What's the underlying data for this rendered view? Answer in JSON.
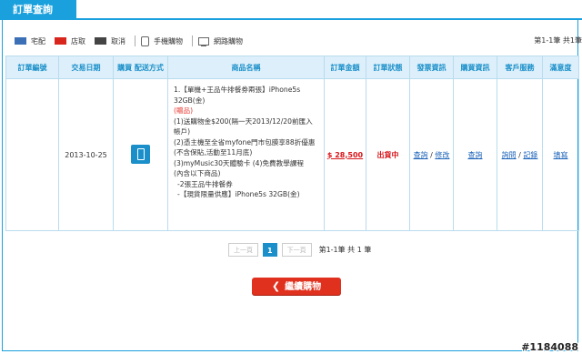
{
  "tab": {
    "title": "訂單查詢"
  },
  "legend": [
    {
      "label": "宅配",
      "color": "#3b6fb6",
      "icon": "swatch"
    },
    {
      "label": "店取",
      "color": "#d8261d",
      "icon": "swatch"
    },
    {
      "label": "取消",
      "color": "#444444",
      "icon": "swatch"
    },
    {
      "label": "手機購物",
      "icon": "mobile-icon"
    },
    {
      "label": "網路購物",
      "icon": "monitor-icon"
    }
  ],
  "count_text": "第1-1筆 共1筆",
  "columns": [
    "訂單編號",
    "交易日期",
    "購買 配送方式",
    "商品名稱",
    "訂單金額",
    "訂單狀態",
    "發票資訊",
    "購買資訊",
    "客戶服務",
    "滿意度"
  ],
  "order": {
    "order_no": "",
    "date": "2013-10-25",
    "product_lines": [
      "1.【單機+王品牛排餐券兩張】iPhone5s 32GB(金)",
      "(贈品)",
      "(1)送購物金$200(隔一天2013/12/20前匯入帳戶)",
      "(2)憑主機至全省myfone門市包膜享88折優惠(不含保貼,活動至11月底)",
      "(3)myMusic30天體驗卡 (4)免費教學課程",
      "(內含以下商品)",
      "-2張王品牛排餐券",
      "-【現貨限量供應】iPhone5s 32GB(金)"
    ],
    "amount": "$ 28,500",
    "status": "出貨中",
    "invoice_links": [
      "查詢",
      "修改"
    ],
    "purchase_link": "查詢",
    "service_links": [
      "詢問",
      "記錄"
    ],
    "satisfaction_link": "填寫"
  },
  "pager": {
    "prev": "上一頁",
    "current": "1",
    "next": "下一頁",
    "info": "第1-1筆 共 1 筆"
  },
  "continue_button": {
    "label": "繼續購物"
  },
  "watermark": "#1184088"
}
